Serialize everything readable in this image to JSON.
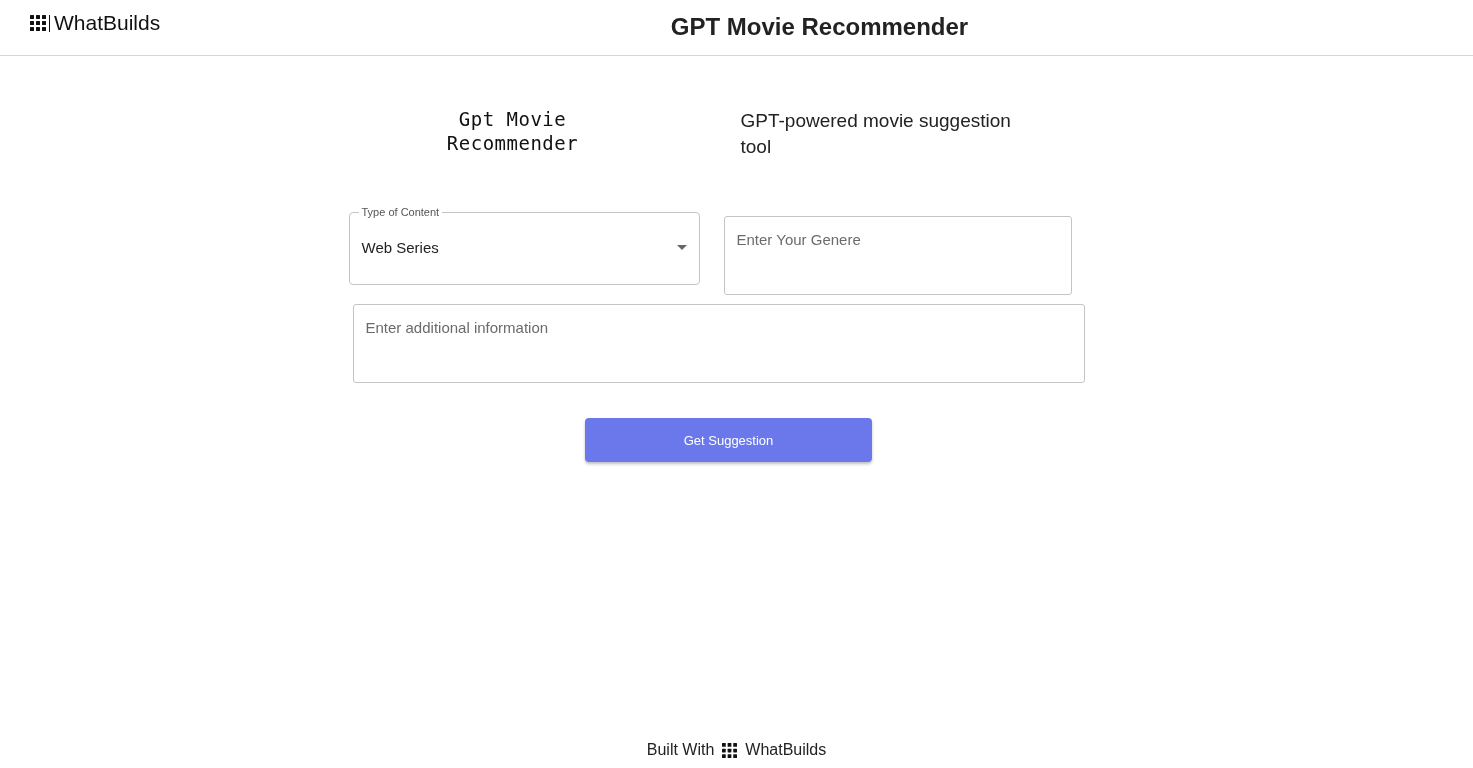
{
  "header": {
    "brand": "WhatBuilds",
    "title": "GPT Movie Recommender"
  },
  "hero": {
    "logo_text": "Gpt Movie Recommender",
    "tagline": "GPT-powered movie suggestion tool"
  },
  "form": {
    "content_type": {
      "label": "Type of Content",
      "value": "Web Series"
    },
    "genre": {
      "placeholder": "Enter Your Genere"
    },
    "additional_info": {
      "placeholder": "Enter additional information"
    },
    "submit": "Get Suggestion"
  },
  "footer": {
    "prefix": "Built With",
    "brand": "WhatBuilds"
  }
}
